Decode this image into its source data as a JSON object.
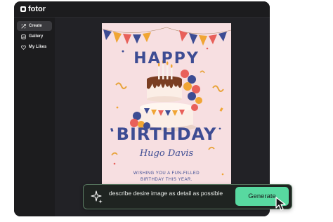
{
  "app": {
    "brand": "fotor"
  },
  "sidebar": {
    "items": [
      {
        "label": "Create",
        "icon": "create-icon"
      },
      {
        "label": "Gallery",
        "icon": "gallery-icon"
      },
      {
        "label": "My Likes",
        "icon": "heart-icon"
      }
    ]
  },
  "card": {
    "happy": "HAPPY",
    "birthday": "BIRTHDAY",
    "name": "Hugo Davis",
    "wish_line1": "WISHING YOU A FUN-FILLED",
    "wish_line2": "BIRTHDAY THIS YEAR."
  },
  "prompt": {
    "text": "describe desire image as detail as possible",
    "generate_label": "Generate"
  },
  "colors": {
    "app_bg": "#1c1c1e",
    "accent": "#58d9a0",
    "card_bg": "#f7dfe1",
    "card_text": "#3d4c93"
  }
}
